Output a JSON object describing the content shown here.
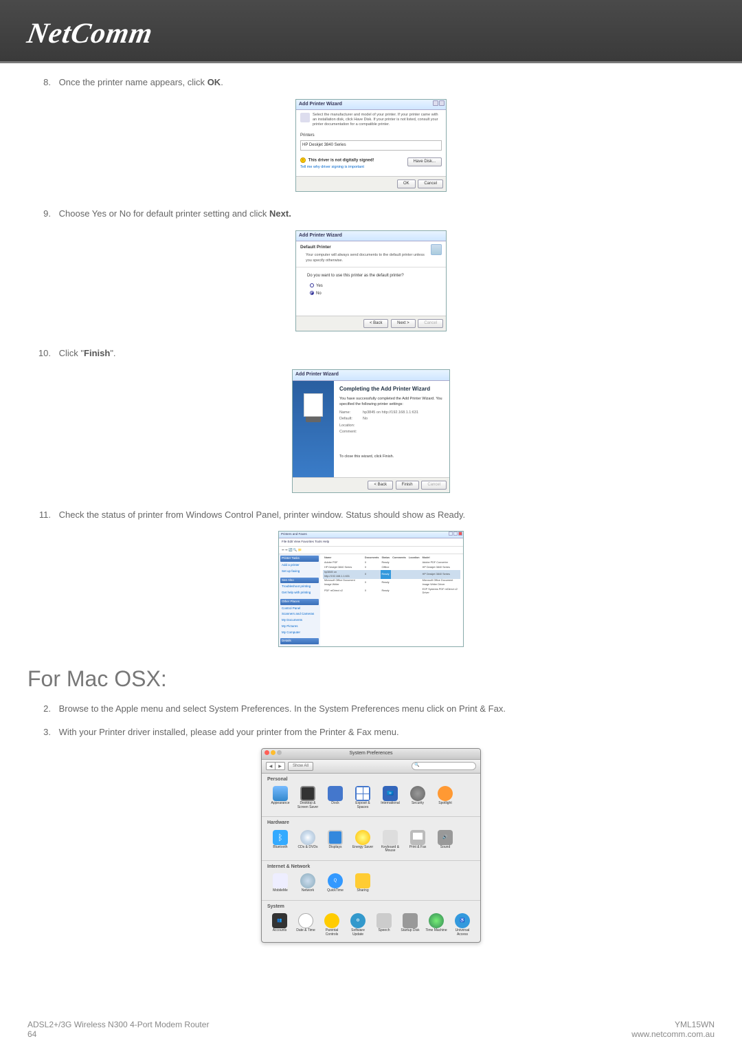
{
  "header": {
    "brand": "NetComm"
  },
  "steps": {
    "s8": {
      "num": "8.",
      "text_a": "Once the printer name appears, click ",
      "ok": "OK",
      "text_b": "."
    },
    "s9": {
      "num": "9.",
      "text_a": "Choose Yes or No for default printer setting and click ",
      "next": "Next."
    },
    "s10": {
      "num": "10.",
      "text_a": "Click \"",
      "finish": "Finish",
      "text_b": "\"."
    },
    "s11": {
      "num": "11.",
      "text": "Check the status of printer from Windows Control Panel, printer window. Status should show as Ready."
    }
  },
  "wiz1": {
    "title": "Add Printer Wizard",
    "instr": "Select the manufacturer and model of your printer. If your printer came with an installation disk, click Have Disk. If your printer is not listed, consult your printer documentation for a compatible printer.",
    "printers_label": "Printers",
    "printer_item": "HP Deskjet 3840 Series",
    "not_signed": "This driver is not digitally signed!",
    "tell_me": "Tell me why driver signing is important",
    "have_disk": "Have Disk...",
    "ok": "OK",
    "cancel": "Cancel"
  },
  "wiz2": {
    "title": "Add Printer Wizard",
    "heading": "Default Printer",
    "sub": "Your computer will always send documents to the default printer unless you specify otherwise.",
    "question": "Do you want to use this printer as the default printer?",
    "yes": "Yes",
    "no": "No",
    "back": "< Back",
    "next": "Next >",
    "cancel": "Cancel"
  },
  "wiz3": {
    "title": "Add Printer Wizard",
    "heading": "Completing the Add Printer Wizard",
    "p1": "You have successfully completed the Add Printer Wizard. You specified the following printer settings:",
    "name_k": "Name:",
    "name_v": "hp3845 on http://192.168.1.1:631",
    "default_k": "Default:",
    "default_v": "No",
    "loc_k": "Location:",
    "com_k": "Comment:",
    "close": "To close this wizard, click Finish.",
    "back": "< Back",
    "finish": "Finish",
    "cancel": "Cancel"
  },
  "cp": {
    "title": "Printers and Faxes",
    "menu": "File   Edit   View   Favorites   Tools   Help",
    "side": {
      "tasks": "Printer Tasks",
      "t1": "Add a printer",
      "t2": "Set up faxing",
      "see": "See Also",
      "s1": "Troubleshoot printing",
      "s2": "Get help with printing",
      "other": "Other Places",
      "o1": "Control Panel",
      "o2": "Scanners and Cameras",
      "o3": "My Documents",
      "o4": "My Pictures",
      "o5": "My Computer",
      "details": "Details"
    },
    "cols": {
      "name": "Name",
      "doc": "Documents",
      "status": "Status",
      "comments": "Comments",
      "location": "Location",
      "model": "Model"
    },
    "rows": [
      {
        "name": "Adobe PDF",
        "doc": "0",
        "status": "Ready",
        "model": "Adobe PDF Converter"
      },
      {
        "name": "HP Deskjet 3840 Series",
        "doc": "0",
        "status": "Offline",
        "model": "HP Deskjet 3840 Series"
      },
      {
        "name": "hp3845 on http://192.168.1.1:631",
        "doc": "0",
        "status": "Ready",
        "model": "HP Deskjet 3840 Series"
      },
      {
        "name": "Microsoft Office Document Image Writer",
        "doc": "0",
        "status": "Ready",
        "model": "Microsoft Office Document Image Writer Driver"
      },
      {
        "name": "PDF reDirect v2",
        "doc": "0",
        "status": "Ready",
        "model": "EXP Systems PDF reDirect v2 Driver"
      }
    ]
  },
  "macosx": {
    "heading": "For Mac OSX:",
    "s2": {
      "num": "2.",
      "text": "Browse to the Apple menu and select System Preferences. In the System Preferences menu click on Print & Fax."
    },
    "s3": {
      "num": "3.",
      "text": "With your Printer driver installed, please add your printer from the Printer & Fax menu."
    }
  },
  "sysprefs": {
    "title": "System Preferences",
    "showall": "Show All",
    "sections": {
      "personal": "Personal",
      "hardware": "Hardware",
      "internet": "Internet & Network",
      "system": "System"
    },
    "items": {
      "appearance": "Appearance",
      "desktop": "Desktop & Screen Saver",
      "dock": "Dock",
      "expose": "Exposé & Spaces",
      "intl": "International",
      "security": "Security",
      "spotlight": "Spotlight",
      "bluetooth": "Bluetooth",
      "cds": "CDs & DVDs",
      "displays": "Displays",
      "energy": "Energy Saver",
      "keyboard": "Keyboard & Mouse",
      "printfax": "Print & Fax",
      "sound": "Sound",
      "mobileme": "MobileMe",
      "network": "Network",
      "quicktime": "QuickTime",
      "sharing": "Sharing",
      "accounts": "Accounts",
      "datetime": "Date & Time",
      "parental": "Parental Controls",
      "software": "Software Update",
      "speech": "Speech",
      "startup": "Startup Disk",
      "timemachine": "Time Machine",
      "universal": "Universal Access"
    }
  },
  "footer": {
    "left1": "ADSL2+/3G Wireless N300 4-Port Modem Router",
    "left2": "64",
    "right1": "YML15WN",
    "right2": "www.netcomm.com.au"
  }
}
